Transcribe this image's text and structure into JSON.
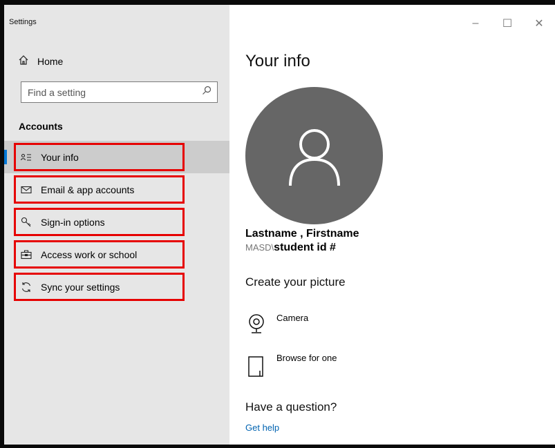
{
  "window": {
    "title": "Settings",
    "controls": {
      "minimize": "–",
      "maximize": "☐",
      "close": "✕"
    }
  },
  "sidebar": {
    "home_label": "Home",
    "search": {
      "placeholder": "Find a setting",
      "value": ""
    },
    "section_title": "Accounts",
    "items": [
      {
        "label": "Your info",
        "icon": "user-list-icon",
        "active": true
      },
      {
        "label": "Email & app accounts",
        "icon": "mail-icon",
        "active": false
      },
      {
        "label": "Sign-in options",
        "icon": "key-icon",
        "active": false
      },
      {
        "label": "Access work or school",
        "icon": "briefcase-icon",
        "active": false
      },
      {
        "label": "Sync your settings",
        "icon": "sync-icon",
        "active": false
      }
    ]
  },
  "main": {
    "title": "Your info",
    "user": {
      "name": "Lastname , Firstname",
      "domain": "MASD\\",
      "account_id": "student id #"
    },
    "create_picture": {
      "title": "Create your picture",
      "options": [
        {
          "label": "Camera",
          "icon": "camera-icon"
        },
        {
          "label": "Browse for one",
          "icon": "file-icon"
        }
      ]
    },
    "help": {
      "title": "Have a question?",
      "link": "Get help"
    }
  },
  "colors": {
    "accent": "#0078d7",
    "highlight_border": "#e60000",
    "sidebar_bg": "#e6e6e6",
    "avatar_bg": "#666666",
    "link": "#0063b1"
  }
}
